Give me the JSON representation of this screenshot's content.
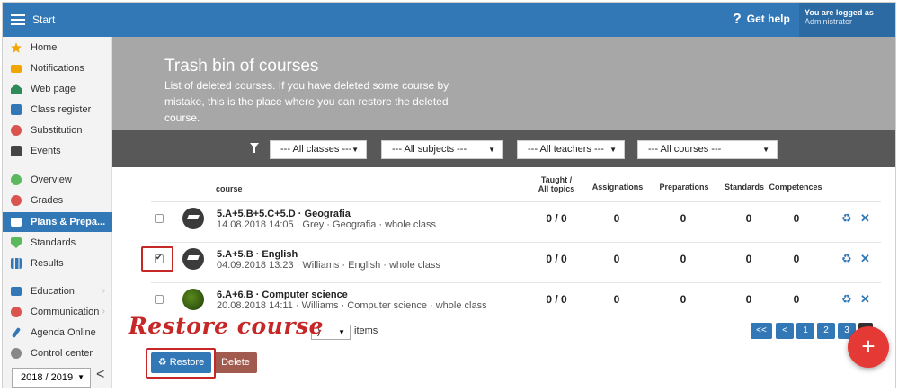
{
  "topbar": {
    "title": "Start",
    "help": "Get help",
    "user_line1": "You are logged as",
    "user_line2": "Administrator"
  },
  "sidebar": {
    "items": [
      {
        "label": "Home",
        "icon": "star-icon",
        "color": "#f0a500"
      },
      {
        "label": "Notifications",
        "icon": "envelope-icon",
        "color": "#f0a500"
      },
      {
        "label": "Web page",
        "icon": "house-icon",
        "color": "#2e8b57"
      },
      {
        "label": "Class register",
        "icon": "book-icon",
        "color": "#3278b7"
      },
      {
        "label": "Substitution",
        "icon": "person-icon",
        "color": "#d9534f"
      },
      {
        "label": "Events",
        "icon": "calendar-icon",
        "color": "#444444"
      },
      {
        "label": "Overview",
        "icon": "check-circle-icon",
        "color": "#5cb85c"
      },
      {
        "label": "Grades",
        "icon": "grades-icon",
        "color": "#d9534f"
      },
      {
        "label": "Plans & Prepa...",
        "icon": "briefcase-icon",
        "color": "#ffffff"
      },
      {
        "label": "Standards",
        "icon": "shield-icon",
        "color": "#5cb85c"
      },
      {
        "label": "Results",
        "icon": "bar-chart-icon",
        "color": "#3278b7"
      },
      {
        "label": "Education",
        "icon": "education-icon",
        "color": "#3278b7"
      },
      {
        "label": "Communication",
        "icon": "chat-icon",
        "color": "#d9534f"
      },
      {
        "label": "Agenda Online",
        "icon": "pen-icon",
        "color": "#3278b7"
      },
      {
        "label": "Control center",
        "icon": "gear-icon",
        "color": "#888888"
      }
    ],
    "year": "2018 / 2019",
    "collapse": "<"
  },
  "banner": {
    "title": "Trash bin of courses",
    "text": "List of deleted courses. If you have deleted some course by mistake, this is the place where you can restore the deleted course."
  },
  "filters": {
    "classes": "--- All classes ---",
    "subjects": "--- All subjects ---",
    "teachers": "--- All teachers ---",
    "courses": "--- All courses ---"
  },
  "table": {
    "headers": {
      "course": "course",
      "taught_1": "Taught /",
      "taught_2": "All topics",
      "assignations": "Assignations",
      "preparations": "Preparations",
      "standards": "Standards",
      "competences": "Competences"
    },
    "rows": [
      {
        "name": "5.A+5.B+5.C+5.D · Geografia",
        "meta": "14.08.2018 14:05 · Grey · Geografia · whole class",
        "taught": "0 / 0",
        "assignations": "0",
        "preparations": "0",
        "standards": "0",
        "competences": "0",
        "checked": false
      },
      {
        "name": "5.A+5.B · English",
        "meta": "04.09.2018 13:23 · Williams · English · whole class",
        "taught": "0 / 0",
        "assignations": "0",
        "preparations": "0",
        "standards": "0",
        "competences": "0",
        "checked": true
      },
      {
        "name": "6.A+6.B · Computer science",
        "meta": "20.08.2018 14:11 · Williams · Computer science · whole class",
        "taught": "0 / 0",
        "assignations": "0",
        "preparations": "0",
        "standards": "0",
        "competences": "0",
        "checked": false
      }
    ]
  },
  "annotation": "Restore course",
  "paging": {
    "items_value": ")",
    "items_label": "items",
    "pages": [
      "<<",
      "<",
      "1",
      "2",
      "3"
    ]
  },
  "buttons": {
    "restore": "Restore",
    "delete": "Delete",
    "fab": "+"
  },
  "colors": {
    "primary": "#3278b7",
    "danger": "#c62828",
    "delete": "#a05a4e"
  }
}
